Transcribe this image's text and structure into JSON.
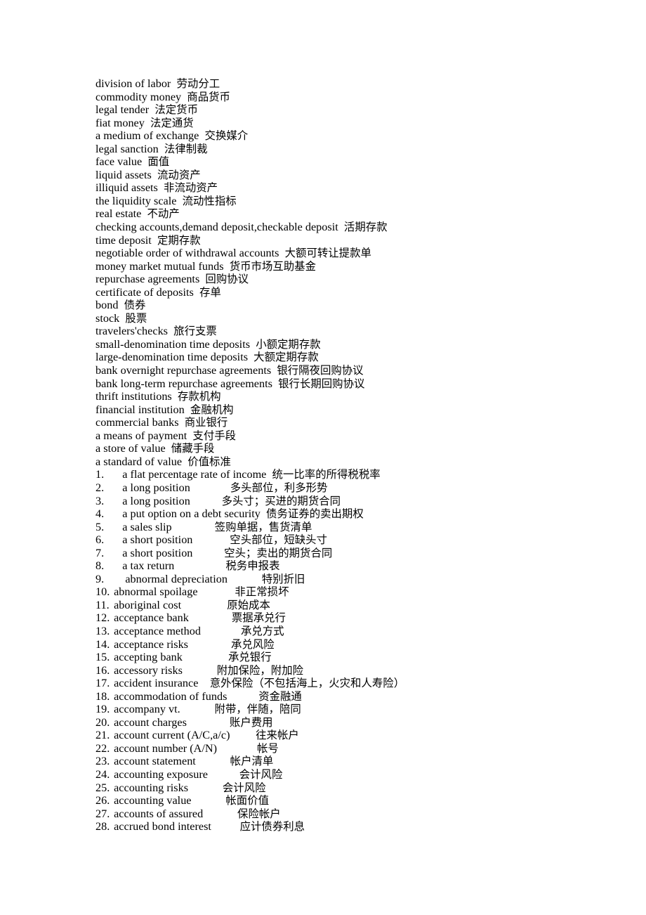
{
  "document": {
    "glossary_terms": [
      {
        "en": "division of labor",
        "zh": "劳动分工",
        "sep": "  "
      },
      {
        "en": "commodity money",
        "zh": "商品货币",
        "sep": "  "
      },
      {
        "en": "legal tender",
        "zh": "法定货币",
        "sep": "  "
      },
      {
        "en": "fiat money",
        "zh": "法定通货",
        "sep": "  "
      },
      {
        "en": "a medium of exchange",
        "zh": "交换媒介",
        "sep": "  "
      },
      {
        "en": "legal sanction",
        "zh": "法律制裁",
        "sep": "  "
      },
      {
        "en": "face value",
        "zh": "面值",
        "sep": "  "
      },
      {
        "en": "liquid assets",
        "zh": "流动资产",
        "sep": "  "
      },
      {
        "en": "illiquid assets",
        "zh": "非流动资产",
        "sep": "  "
      },
      {
        "en": "the liquidity scale",
        "zh": "流动性指标",
        "sep": "  "
      },
      {
        "en": "real estate",
        "zh": "不动产",
        "sep": "  "
      },
      {
        "en": "checking accounts,demand deposit,checkable deposit",
        "zh": "活期存款",
        "sep": "  "
      },
      {
        "en": "time deposit",
        "zh": "定期存款",
        "sep": "  "
      },
      {
        "en": "negotiable order of withdrawal accounts",
        "zh": "大额可转让提款单",
        "sep": "  "
      },
      {
        "en": "money market mutual funds",
        "zh": "货币市场互助基金",
        "sep": "  "
      },
      {
        "en": "repurchase agreements",
        "zh": "回购协议",
        "sep": "  "
      },
      {
        "en": "certificate of deposits",
        "zh": "存单",
        "sep": "  "
      },
      {
        "en": "bond",
        "zh": "债券",
        "sep": "  "
      },
      {
        "en": "stock",
        "zh": "股票",
        "sep": "  "
      },
      {
        "en": "travelers'checks",
        "zh": "旅行支票",
        "sep": "  "
      },
      {
        "en": "small-denomination time deposits",
        "zh": "小额定期存款",
        "sep": "  "
      },
      {
        "en": "large-denomination time deposits",
        "zh": "大额定期存款",
        "sep": "  "
      },
      {
        "en": "bank overnight repurchase agreements",
        "zh": "银行隔夜回购协议",
        "sep": "  "
      },
      {
        "en": "bank long-term repurchase agreements",
        "zh": "银行长期回购协议",
        "sep": "  "
      },
      {
        "en": "thrift institutions",
        "zh": "存款机构",
        "sep": "  "
      },
      {
        "en": "financial institution",
        "zh": "金融机构",
        "sep": "  "
      },
      {
        "en": "commercial banks",
        "zh": "商业银行",
        "sep": "  "
      },
      {
        "en": "a means of payment",
        "zh": "支付手段",
        "sep": "  "
      },
      {
        "en": "a store of value",
        "zh": "储藏手段",
        "sep": "  "
      },
      {
        "en": "a standard of value",
        "zh": "价值标准",
        "sep": "  "
      }
    ],
    "numbered_terms": [
      {
        "num": "1.",
        "en": "a flat percentage rate of income",
        "zh": "统一比率的所得税税率",
        "indent": "    ",
        "sep": "  "
      },
      {
        "num": "2.",
        "en": "a long position",
        "zh": "多头部位，利多形势",
        "indent": "    ",
        "sep": "              "
      },
      {
        "num": "3.",
        "en": "a long position",
        "zh": "多头寸；买进的期货合同",
        "indent": "    ",
        "sep": "           "
      },
      {
        "num": "4.",
        "en": "a put option on a debt security",
        "zh": "债务证券的卖出期权",
        "indent": "    ",
        "sep": "  "
      },
      {
        "num": "5.",
        "en": "a sales slip",
        "zh": "签购单据，售货清单",
        "indent": "    ",
        "sep": "               "
      },
      {
        "num": "6.",
        "en": "a short position",
        "zh": "空头部位，短缺头寸",
        "indent": "    ",
        "sep": "             "
      },
      {
        "num": "7.",
        "en": "a short position",
        "zh": "空头；卖出的期货合同",
        "indent": "    ",
        "sep": "           "
      },
      {
        "num": "8.",
        "en": "a tax return",
        "zh": "税务申报表",
        "indent": "    ",
        "sep": "                  "
      },
      {
        "num": "9.",
        "en": "abnormal depreciation",
        "zh": "特别折旧",
        "indent": "     ",
        "sep": "            "
      },
      {
        "num": "10.",
        "en": "abnormal spoilage",
        "zh": "非正常损坏",
        "indent": " ",
        "sep": "             "
      },
      {
        "num": "11.",
        "en": "aboriginal cost",
        "zh": "原始成本",
        "indent": " ",
        "sep": "                "
      },
      {
        "num": "12.",
        "en": "acceptance bank",
        "zh": "票据承兑行",
        "indent": " ",
        "sep": "               "
      },
      {
        "num": "13.",
        "en": "acceptance method",
        "zh": "承兑方式",
        "indent": " ",
        "sep": "              "
      },
      {
        "num": "14.",
        "en": "acceptance risks",
        "zh": "承兑风险",
        "indent": " ",
        "sep": "               "
      },
      {
        "num": "15.",
        "en": "accepting bank",
        "zh": "承兑银行",
        "indent": " ",
        "sep": "                "
      },
      {
        "num": "16.",
        "en": "accessory risks",
        "zh": "附加保险，附加险",
        "indent": " ",
        "sep": "            "
      },
      {
        "num": "17.",
        "en": "accident insurance",
        "zh": "意外保险（不包括海上，火灾和人寿险）",
        "indent": " ",
        "sep": "    "
      },
      {
        "num": "18.",
        "en": "accommodation of funds",
        "zh": "资金融通",
        "indent": " ",
        "sep": "           "
      },
      {
        "num": "19.",
        "en": "accompany vt.",
        "zh": "附带，伴随，陪同",
        "indent": " ",
        "sep": "            "
      },
      {
        "num": "20.",
        "en": "account charges",
        "zh": "账户费用",
        "indent": " ",
        "sep": "               "
      },
      {
        "num": "21.",
        "en": "account current (A/C,a/c)",
        "zh": "往来帐户",
        "indent": " ",
        "sep": "         "
      },
      {
        "num": "22.",
        "en": "account number (A/N)",
        "zh": "帐号",
        "indent": " ",
        "sep": "              "
      },
      {
        "num": "23.",
        "en": "account statement",
        "zh": "帐户清单",
        "indent": " ",
        "sep": "            "
      },
      {
        "num": "24.",
        "en": "accounting exposure",
        "zh": "会计风险",
        "indent": " ",
        "sep": "           "
      },
      {
        "num": "25.",
        "en": "accounting risks",
        "zh": "会计风险",
        "indent": " ",
        "sep": "            "
      },
      {
        "num": "26.",
        "en": "accounting value",
        "zh": "帐面价值",
        "indent": " ",
        "sep": "            "
      },
      {
        "num": "27.",
        "en": "accounts of assured",
        "zh": "保险帐户",
        "indent": " ",
        "sep": "            "
      },
      {
        "num": "28.",
        "en": "accrued bond interest",
        "zh": "应计债券利息",
        "indent": " ",
        "sep": "          "
      }
    ]
  }
}
